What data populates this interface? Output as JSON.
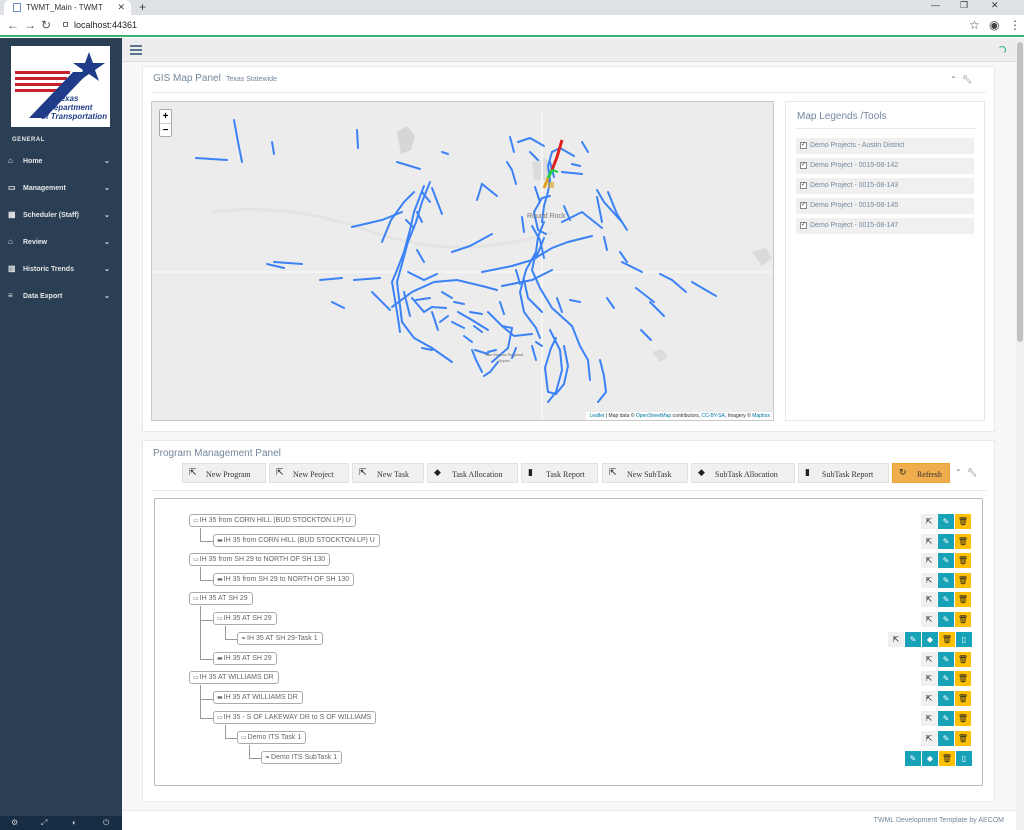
{
  "browser": {
    "tab_title": "TWMT_Main - TWMT",
    "tab_close": "✕",
    "new_tab": "+",
    "url": "localhost:44361",
    "win_min": "—",
    "win_max": "❐",
    "win_close": "✕"
  },
  "sidebar": {
    "logo": {
      "line1": "Texas",
      "line2": "Department",
      "line3": "of Transportation"
    },
    "section_title": "GENERAL",
    "items": [
      {
        "label": "Home",
        "icon": "home-icon"
      },
      {
        "label": "Management",
        "icon": "desktop-icon"
      },
      {
        "label": "Scheduler (Staff)",
        "icon": "calendar-icon"
      },
      {
        "label": "Review",
        "icon": "bank-icon"
      },
      {
        "label": "Historic Trends",
        "icon": "bar-chart-icon"
      },
      {
        "label": "Data Export",
        "icon": "database-icon"
      }
    ]
  },
  "gis_panel": {
    "title": "GIS Map Panel",
    "subtitle": "Texas Statewide",
    "zoom_in": "+",
    "zoom_out": "−",
    "map_labels": {
      "round_rock": "Round Rock",
      "airport_1": "San Marcos Regional",
      "airport_2": "Airport"
    },
    "attribution": {
      "leaflet": "Leaflet",
      "text1": " | Map data © ",
      "osm": "OpenStreetMap",
      "text2": " contributors, ",
      "cc": "CC-BY-SA",
      "text3": ", Imagery © ",
      "mapbox": "Mapbox"
    }
  },
  "legend": {
    "title": "Map Legends /Tools",
    "items": [
      "Demo Projects - Austin District",
      "Demo Project - 0015-08-142",
      "Demo Project - 0015-08-143",
      "Demo Project - 0015-08-145",
      "Demo Project - 0015-08-147"
    ]
  },
  "program_panel": {
    "title": "Program Management Panel",
    "toolbar": [
      {
        "label": "New   Program",
        "icon": "external-link-icon"
      },
      {
        "label": "New   Peoject",
        "icon": "external-link-icon"
      },
      {
        "label": "New   Task",
        "icon": "external-link-icon"
      },
      {
        "label": "Task   Allocation",
        "icon": "tag-icon"
      },
      {
        "label": "Task   Report",
        "icon": "book-icon"
      },
      {
        "label": "New   SubTask",
        "icon": "external-link-icon"
      },
      {
        "label": "SubTask   Allocation",
        "icon": "tag-icon"
      },
      {
        "label": "SubTask   Report",
        "icon": "book-icon"
      },
      {
        "label": "Refresh",
        "icon": "refresh-icon"
      }
    ],
    "tree": [
      "IH 35 from CORN HILL (BUD STOCKTON LP) U",
      "IH 35 from CORN HILL (BUD STOCKTON LP) U",
      "IH 35 from SH 29 to NORTH OF SH 130",
      "IH 35 from SH 29 to NORTH OF SH 130",
      "IH 35 AT SH 29",
      "IH 35 AT SH 29",
      "IH 35 AT SH 29-Task 1",
      "IH 35 AT SH 29",
      "IH 35 AT WILLIAMS DR",
      "IH 35 AT WILLIAMS DR",
      "IH 35 - S OF LAKEWAY DR to S OF WILLIAMS",
      "Demo ITS Task 1",
      "Demo ITS SubTask 1"
    ]
  },
  "footer": "TWML Development Template by AECOM",
  "colors": {
    "sidebar_bg": "#2a3f54",
    "route_blue": "#3b82f6",
    "route_red": "#e02020",
    "route_green": "#22cc44",
    "btn_blue": "#17a2b8",
    "btn_yellow": "#ffc107",
    "refresh_bg": "#f0ad4e"
  }
}
